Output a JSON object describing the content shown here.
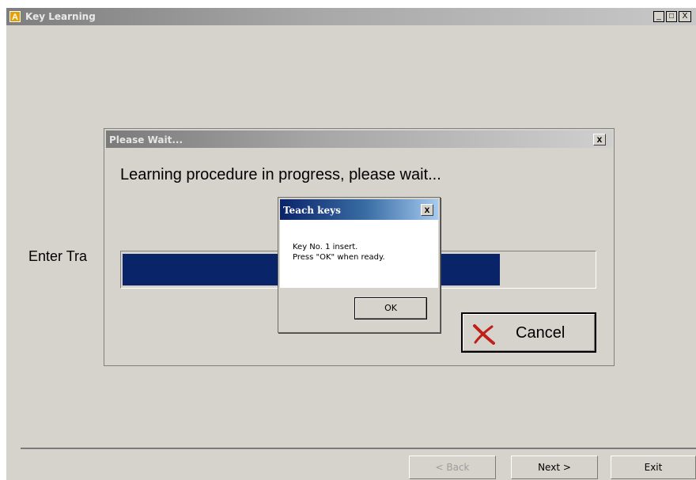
{
  "main_window": {
    "title": "Key Learning",
    "app_icon_letter": "A",
    "controls": {
      "minimize": "_",
      "maximize": "□",
      "close": "X"
    },
    "step_text": "Enter Tra"
  },
  "nav": {
    "back_label": "< Back",
    "next_label": "Next >",
    "exit_label": "Exit"
  },
  "wait_dialog": {
    "title": "Please Wait...",
    "close_label": "x",
    "message": "Learning procedure in progress, please wait...",
    "progress": 0.8,
    "progress_color": "#0a246a",
    "cancel_label": "Cancel",
    "cancel_icon": "red-x-icon"
  },
  "teach_dialog": {
    "title": "Teach keys",
    "close_label": "x",
    "line1": "Key No. 1 insert.",
    "line2": "Press \"OK\" when ready.",
    "ok_label": "OK"
  }
}
